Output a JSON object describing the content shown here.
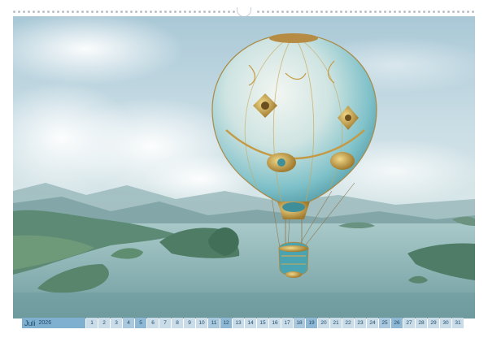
{
  "calendar": {
    "month": "Juli",
    "year": "2026",
    "days": [
      {
        "d": "1",
        "t": "wd"
      },
      {
        "d": "2",
        "t": "wd"
      },
      {
        "d": "3",
        "t": "wd"
      },
      {
        "d": "4",
        "t": "sat"
      },
      {
        "d": "5",
        "t": "sun"
      },
      {
        "d": "6",
        "t": "wd"
      },
      {
        "d": "7",
        "t": "wd"
      },
      {
        "d": "8",
        "t": "wd"
      },
      {
        "d": "9",
        "t": "wd"
      },
      {
        "d": "10",
        "t": "wd"
      },
      {
        "d": "11",
        "t": "sat"
      },
      {
        "d": "12",
        "t": "sun"
      },
      {
        "d": "13",
        "t": "wd"
      },
      {
        "d": "14",
        "t": "wd"
      },
      {
        "d": "15",
        "t": "wd"
      },
      {
        "d": "16",
        "t": "wd"
      },
      {
        "d": "17",
        "t": "wd"
      },
      {
        "d": "18",
        "t": "sat"
      },
      {
        "d": "19",
        "t": "sun"
      },
      {
        "d": "20",
        "t": "wd"
      },
      {
        "d": "21",
        "t": "wd"
      },
      {
        "d": "22",
        "t": "wd"
      },
      {
        "d": "23",
        "t": "wd"
      },
      {
        "d": "24",
        "t": "wd"
      },
      {
        "d": "25",
        "t": "sat"
      },
      {
        "d": "26",
        "t": "sun"
      },
      {
        "d": "27",
        "t": "wd"
      },
      {
        "d": "28",
        "t": "wd"
      },
      {
        "d": "29",
        "t": "wd"
      },
      {
        "d": "30",
        "t": "wd"
      },
      {
        "d": "31",
        "t": "wd"
      }
    ]
  },
  "colors": {
    "month_bar": "#7fb0cf",
    "weekday": "#c9dce8",
    "saturday": "#a9c8dd",
    "sunday": "#8fb8d4",
    "text": "#1f4a68"
  },
  "photo": {
    "subject": "ornate-hot-air-balloon-over-sea-islands"
  }
}
